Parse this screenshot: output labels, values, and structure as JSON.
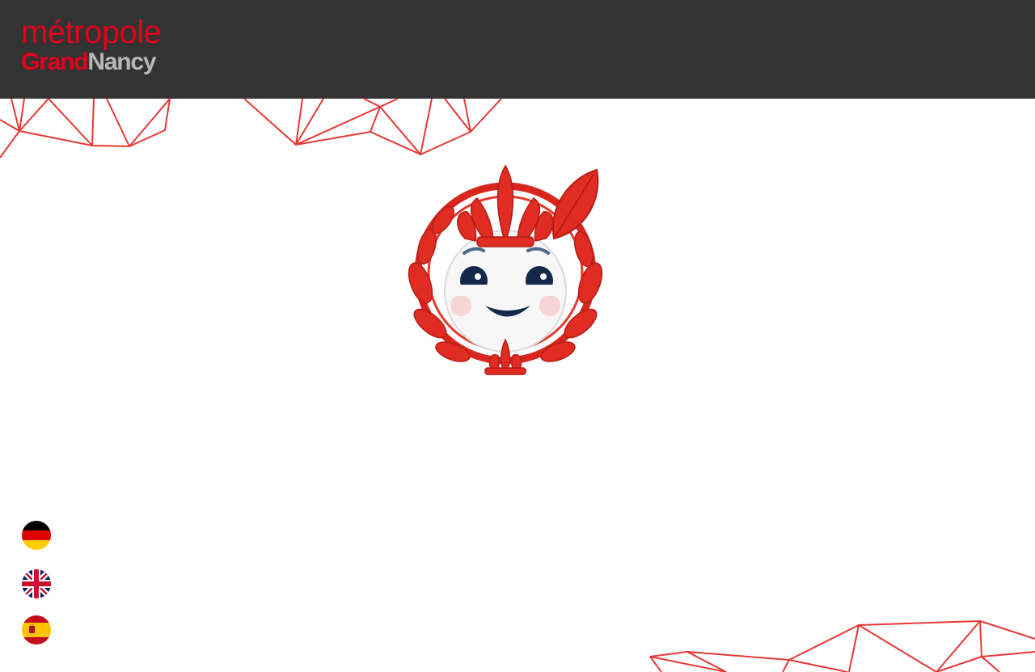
{
  "header": {
    "logo": {
      "line1": "métropole",
      "line2_part1": "Grand",
      "line2_part2": "Nancy"
    },
    "background_color": "#333333"
  },
  "colors": {
    "brand_red": "#e2001a",
    "logo_grey": "#b7b7b7",
    "decor_line": "#e53935",
    "page_background": "#ffffff"
  },
  "mascot": {
    "icon": "laurel-wreath-smiley-mascot-icon"
  },
  "languages": [
    {
      "code": "de",
      "icon": "germany-flag-icon"
    },
    {
      "code": "en",
      "icon": "united-kingdom-flag-icon"
    },
    {
      "code": "es",
      "icon": "spain-flag-icon"
    }
  ]
}
